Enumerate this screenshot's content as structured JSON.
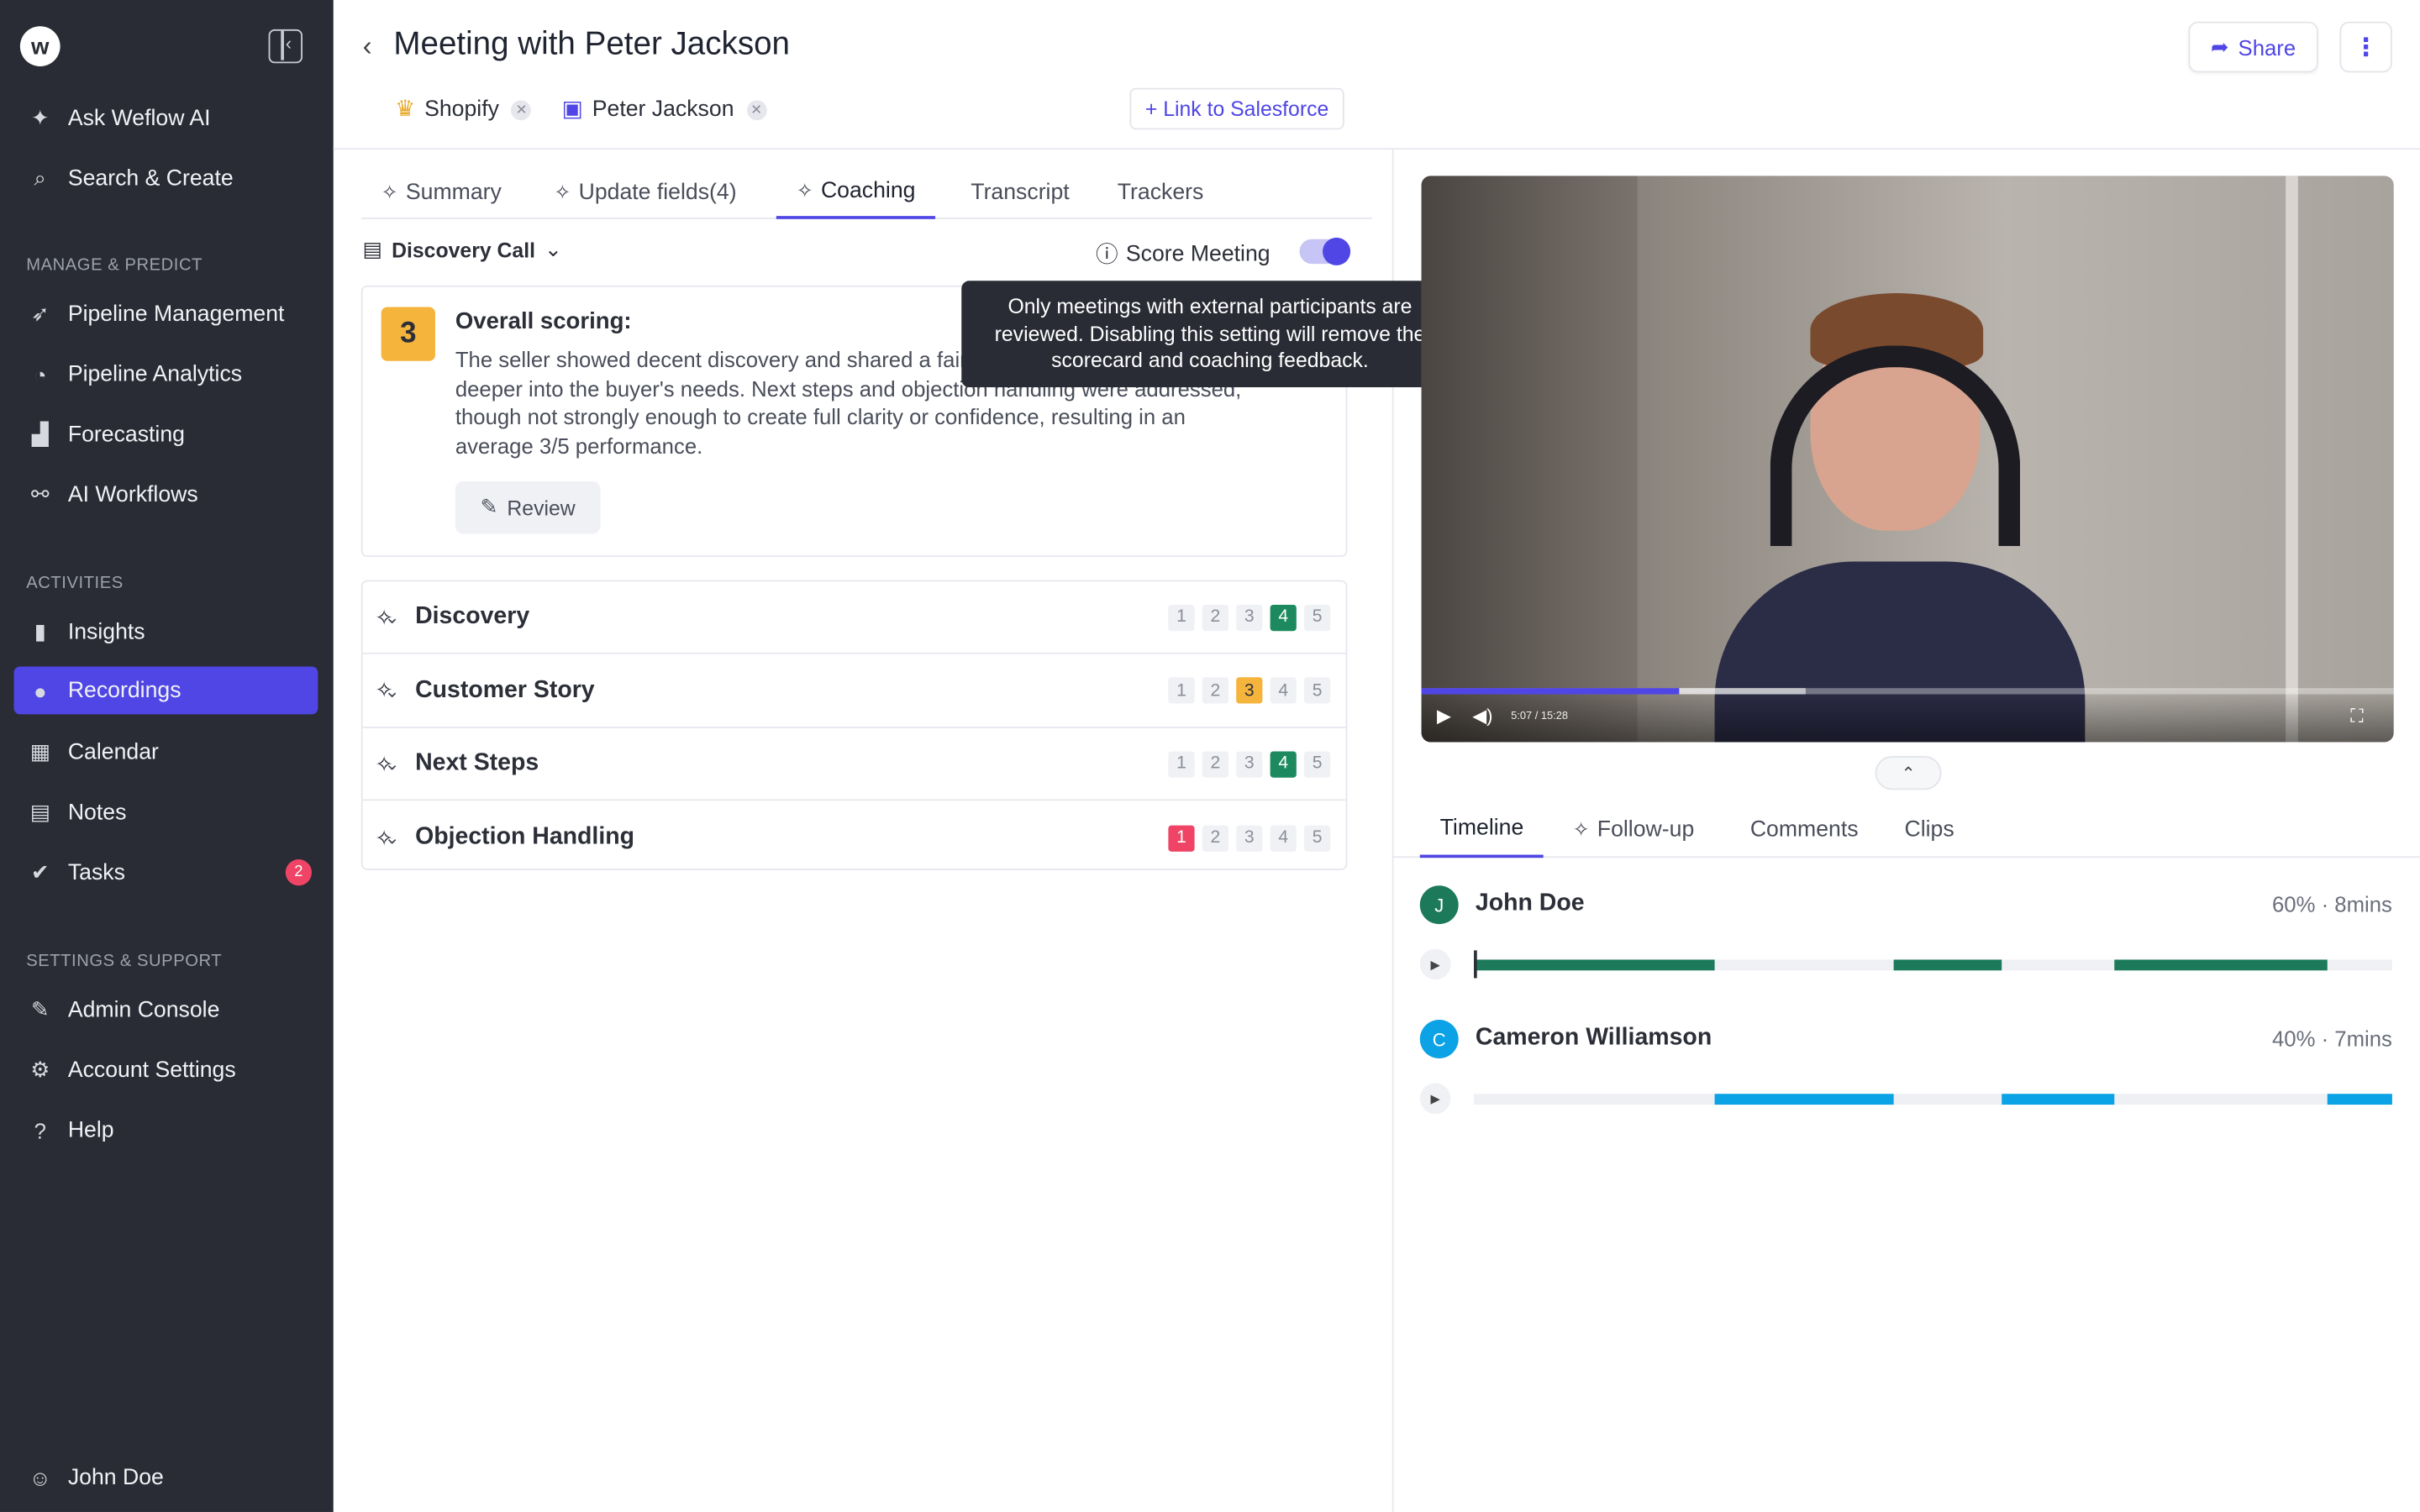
{
  "sidebar": {
    "logo_glyph": "w",
    "top_items": [
      {
        "label": "Ask Weflow AI",
        "icon": "sparkle-icon"
      },
      {
        "label": "Search & Create",
        "icon": "search-plus-icon"
      }
    ],
    "sections": [
      {
        "title": "Manage & Predict",
        "items": [
          {
            "label": "Pipeline Management",
            "icon": "rocket-icon"
          },
          {
            "label": "Pipeline Analytics",
            "icon": "analytics-icon"
          },
          {
            "label": "Forecasting",
            "icon": "forecast-icon"
          },
          {
            "label": "AI Workflows",
            "icon": "workflow-icon"
          }
        ]
      },
      {
        "title": "Activities",
        "items": [
          {
            "label": "Insights",
            "icon": "bar-chart-icon"
          },
          {
            "label": "Recordings",
            "icon": "record-icon",
            "active": true
          },
          {
            "label": "Calendar",
            "icon": "calendar-icon"
          },
          {
            "label": "Notes",
            "icon": "notes-icon"
          },
          {
            "label": "Tasks",
            "icon": "check-circle-icon",
            "badge": "2"
          }
        ]
      },
      {
        "title": "Settings & Support",
        "items": [
          {
            "label": "Admin Console",
            "icon": "wrench-icon"
          },
          {
            "label": "Account Settings",
            "icon": "gear-icon"
          },
          {
            "label": "Help",
            "icon": "help-icon"
          }
        ]
      }
    ],
    "user": "John Doe",
    "active_color": "#4f46e5"
  },
  "header": {
    "title": "Meeting with Peter Jackson",
    "chips": [
      {
        "label": "Shopify",
        "icon": "crown-icon"
      },
      {
        "label": "Peter Jackson",
        "icon": "contact-card-icon"
      }
    ],
    "link_salesforce": "+ Link to Salesforce",
    "share": "Share"
  },
  "left_tabs": [
    {
      "label": "Summary",
      "spark": true
    },
    {
      "label": "Update fields(4)",
      "spark": true
    },
    {
      "label": "Coaching",
      "spark": true,
      "active": true
    },
    {
      "label": "Transcript",
      "spark": false
    },
    {
      "label": "Trackers",
      "spark": false
    }
  ],
  "coaching": {
    "template": "Discovery Call",
    "score_meeting_label": "Score Meeting",
    "score_meeting_enabled": true,
    "tooltip": "Only meetings with external participants are reviewed. Disabling this setting will remove the scorecard and coaching feedback.",
    "overall": {
      "score": "3",
      "title": "Overall scoring:",
      "text": "The seller showed decent discovery and shared a fairly high-level without digging deeper into the buyer's needs. Next steps and objection handling were addressed, though not strongly enough to create full clarity or confidence, resulting in an average 3/5 performance.",
      "review_label": "Review"
    },
    "criteria": [
      {
        "name": "Discovery",
        "score": 4
      },
      {
        "name": "Customer Story",
        "score": 3
      },
      {
        "name": "Next Steps",
        "score": 4
      },
      {
        "name": "Objection Handling",
        "score": 1
      }
    ],
    "score_colors": {
      "high": "#1c8a5e",
      "mid": "#f5b43c",
      "low": "#ef4466"
    }
  },
  "video": {
    "time": "5:07 / 15:28",
    "progress": 0.265
  },
  "right_tabs": [
    {
      "label": "Timeline",
      "active": true
    },
    {
      "label": "Follow-up",
      "spark": true
    },
    {
      "label": "Comments"
    },
    {
      "label": "Clips"
    }
  ],
  "speakers": [
    {
      "initial": "J",
      "name": "John Doe",
      "stat": "60% · 8mins",
      "color": "#1c7a5a",
      "segments": [
        [
          0.0,
          0.263
        ],
        [
          0.457,
          0.574
        ],
        [
          0.698,
          0.93
        ]
      ]
    },
    {
      "initial": "C",
      "name": "Cameron Williamson",
      "stat": "40% · 7mins",
      "color": "#0ba2e6",
      "segments": [
        [
          0.263,
          0.457
        ],
        [
          0.574,
          0.698
        ],
        [
          0.93,
          1.0
        ]
      ]
    }
  ]
}
